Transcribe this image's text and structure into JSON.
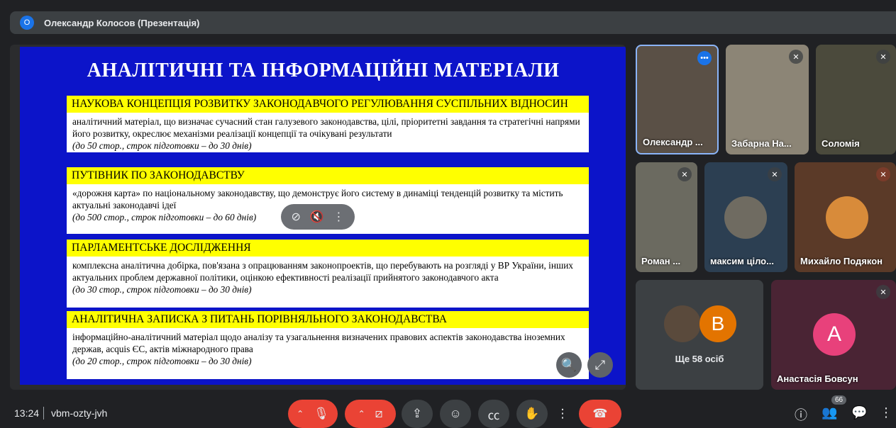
{
  "topbar": {
    "avatar_letter": "О",
    "title": "Олександр Колосов (Презентація)"
  },
  "slide": {
    "title": "АНАЛІТИЧНІ ТА ІНФОРМАЦІЙНІ МАТЕРІАЛИ",
    "blocks": [
      {
        "heading": "НАУКОВА КОНЦЕПЦІЯ РОЗВИТКУ ЗАКОНОДАВЧОГО РЕГУЛЮВАННЯ СУСПІЛЬНИХ ВІДНОСИН",
        "text": "аналітичний матеріал, що визначає сучасний стан галузевого законодавства, цілі, пріоритетні завдання та стратегічні напрями його розвитку, окреслює механізми реалізації концепції та очікувані результати",
        "note": "(до 50 стор., строк підготовки – до 30 днів)"
      },
      {
        "heading": "ПУТІВНИК ПО ЗАКОНОДАВСТВУ",
        "text": "«дорожня карта» по національному законодавству, що демонструє його систему в динаміці тенденцій розвитку та містить актуальні законодавчі ідеї",
        "note": "(до 500 стор., строк підготовки – до 60 днів)"
      },
      {
        "heading": "ПАРЛАМЕНТСЬКЕ ДОСЛІДЖЕННЯ",
        "text": "комплексна аналітична добірка, пов'язана з опрацюванням законопроектів, що перебувають на розгляді у ВР України, інших актуальних проблем державної політики, оцінкою ефективності реалізації прийнятого законодавчого акта",
        "note": "(до 30 стор., строк підготовки – до 30 днів)"
      },
      {
        "heading": "АНАЛІТИЧНА ЗАПИСКА З ПИТАНЬ ПОРІВНЯЛЬНОГО ЗАКОНОДАВСТВА",
        "text": "інформаційно-аналітичний матеріал щодо аналізу та узагальнення визначених правових аспектів законодавства іноземних держав, acquis ЄС, актів міжнародного права",
        "note": "(до 20 стор., строк підготовки – до 30 днів)"
      }
    ]
  },
  "participants": [
    {
      "name": "Олександр ..."
    },
    {
      "name": "Забарна На..."
    },
    {
      "name": "Соломія"
    },
    {
      "name": "Роман ..."
    },
    {
      "name": "максим ціло..."
    },
    {
      "name": "Михайло Подякон"
    }
  ],
  "more": {
    "label": "Ще 58 осіб",
    "letter": "B"
  },
  "anastasia": {
    "name": "Анастасія Бовсун",
    "letter": "A"
  },
  "bottom": {
    "time": "13:24",
    "code": "vbm-ozty-jvh",
    "people_count": "66"
  },
  "colors": {
    "accent": "#1a73e8",
    "end_call": "#ea4335",
    "slide_bg": "#0c14c9",
    "slide_heading": "#ffff00"
  }
}
